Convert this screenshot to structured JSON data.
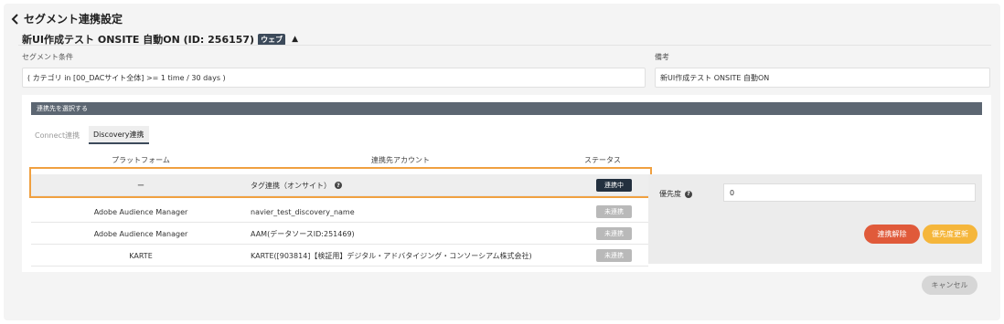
{
  "page": {
    "title": "セグメント連携設定",
    "subtitle": "新UI作成テスト ONSITE 自動ON (ID: 256157)",
    "badge": "ウェブ"
  },
  "fields": {
    "segment_label": "セグメント条件",
    "segment_value": "( カテゴリ in [00_DACサイト全体] >= 1 time / 30 days )",
    "memo_label": "備考",
    "memo_value": "新UI作成テスト ONSITE 自動ON"
  },
  "panel": {
    "header": "連携先を選択する",
    "tabs": [
      {
        "label": "Connect連携",
        "active": false
      },
      {
        "label": "Discovery連携",
        "active": true
      }
    ],
    "columns": {
      "platform": "プラットフォーム",
      "account": "連携先アカウント",
      "status": "ステータス"
    },
    "rows": [
      {
        "platform": "ー",
        "account": "タグ連携（オンサイト）",
        "status": "連携中",
        "linked": true,
        "help": true
      },
      {
        "platform": "Adobe Audience Manager",
        "account": "navier_test_discovery_name",
        "status": "未連携",
        "linked": false
      },
      {
        "platform": "Adobe Audience Manager",
        "account": "AAM(データソースID:251469)",
        "status": "未連携",
        "linked": false
      },
      {
        "platform": "KARTE",
        "account": "KARTE([903814]【検証用】デジタル・アドバタイジング・コンソーシアム株式会社)",
        "status": "未連携",
        "linked": false
      }
    ]
  },
  "detail": {
    "priority_label": "優先度",
    "priority_value": "0",
    "unlink_button": "連携解除",
    "update_priority_button": "優先度更新"
  },
  "footer": {
    "cancel_button": "キャンセル"
  },
  "colors": {
    "header_bg": "#5c6672",
    "linked": "#23303f",
    "unlinked": "#b9b9b9",
    "unlink_btn": "#e05a3a",
    "priority_btn": "#f5b63b",
    "highlight": "#f0a040"
  }
}
